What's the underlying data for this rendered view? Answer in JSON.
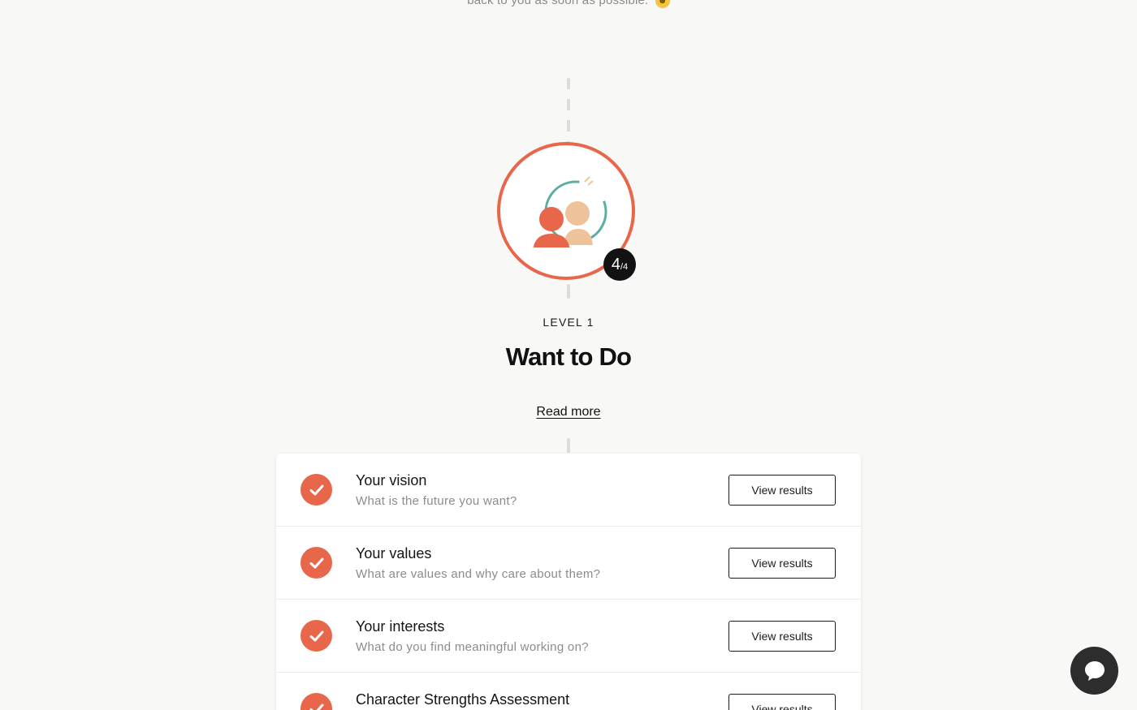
{
  "top_note": {
    "text": "back to you as soon as possible.",
    "emoji": "grinning-face-emoji"
  },
  "level": {
    "progress_current": "4",
    "progress_total": "/4",
    "label": "LEVEL 1",
    "title": "Want to Do",
    "read_more": "Read more",
    "icon": "people-icon",
    "colors": {
      "accent": "#e8674a",
      "ring": "#5aafa2",
      "peach": "#efc39a"
    }
  },
  "checklist": {
    "items": [
      {
        "title": "Your vision",
        "subtitle": "What is the future you want?",
        "button": "View results",
        "status": "completed"
      },
      {
        "title": "Your values",
        "subtitle": "What are values and why care about them?",
        "button": "View results",
        "status": "completed"
      },
      {
        "title": "Your interests",
        "subtitle": "What do you find meaningful working on?",
        "button": "View results",
        "status": "completed"
      },
      {
        "title": "Character Strengths Assessment",
        "subtitle": "",
        "button": "View results",
        "status": "completed"
      }
    ]
  },
  "chat": {
    "icon": "chat-bubble-icon"
  }
}
